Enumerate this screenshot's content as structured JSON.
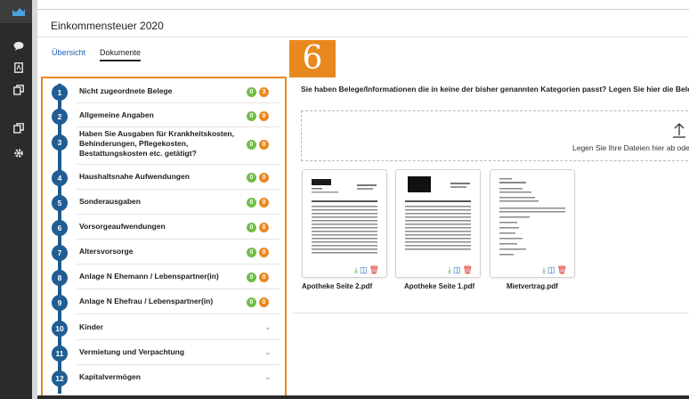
{
  "app": {
    "title": "Einkommensteuer 2020",
    "step_number": "6"
  },
  "tabs": [
    {
      "label": "Übersicht",
      "active": false
    },
    {
      "label": "Dokumente",
      "active": true
    }
  ],
  "sidebar": {
    "items": [
      {
        "icon": "chart-icon",
        "active": true
      },
      {
        "icon": "chat-icon",
        "active": false
      },
      {
        "icon": "pdf-document-icon",
        "active": false
      },
      {
        "icon": "copy-icon",
        "active": false
      },
      {
        "icon": "copy-icon",
        "active": false
      },
      {
        "icon": "gear-icon",
        "active": false
      }
    ]
  },
  "categories": [
    {
      "num": "1",
      "label": "Nicht zugeordnete Belege",
      "green": "0",
      "orange": "3"
    },
    {
      "num": "2",
      "label": "Allgemeine Angaben",
      "green": "0",
      "orange": "0"
    },
    {
      "num": "3",
      "label": "Haben Sie Ausgaben für Krankheitskosten, Behinderungen, Pflegekosten, Bestattungskosten etc. getätigt?",
      "green": "0",
      "orange": "0"
    },
    {
      "num": "4",
      "label": "Haushaltsnahe Aufwendungen",
      "green": "0",
      "orange": "0"
    },
    {
      "num": "5",
      "label": "Sonderausgaben",
      "green": "0",
      "orange": "0"
    },
    {
      "num": "6",
      "label": "Vorsorgeaufwendungen",
      "green": "0",
      "orange": "0"
    },
    {
      "num": "7",
      "label": "Altersvorsorge",
      "green": "0",
      "orange": "0"
    },
    {
      "num": "8",
      "label": "Anlage N Ehemann / Lebenspartner(in)",
      "green": "0",
      "orange": "0"
    },
    {
      "num": "9",
      "label": "Anlage N Ehefrau / Lebenspartner(in)",
      "green": "0",
      "orange": "0"
    },
    {
      "num": "10",
      "label": "Kinder"
    },
    {
      "num": "11",
      "label": "Vermietung und Verpachtung"
    },
    {
      "num": "12",
      "label": "Kapitalvermögen"
    }
  ],
  "main": {
    "heading": "Sie haben Belege/Informationen die in keine der bisher genannten Kategorien passt? Legen Sie hier die Beleg",
    "dropzone_text": "Legen Sie Ihre Dateien hier ab oder"
  },
  "files": [
    {
      "name": "Apotheke Seite 2.pdf"
    },
    {
      "name": "Apotheke Seite 1.pdf"
    },
    {
      "name": "Mietvertrag.pdf"
    }
  ],
  "colors": {
    "accent_orange": "#e8891f",
    "badge_green": "#6fbe44",
    "timeline_blue": "#1f5d93",
    "link_blue": "#1a63b6",
    "sidebar_dark": "#2b2b2b"
  }
}
